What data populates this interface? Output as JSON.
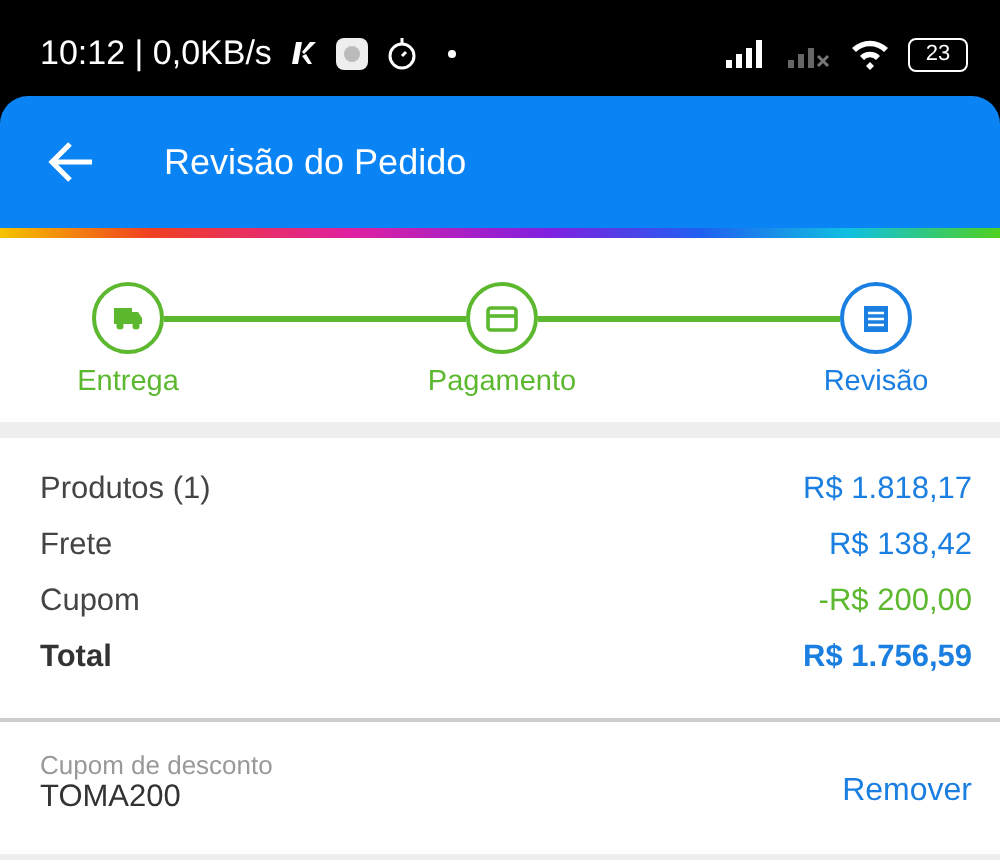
{
  "status_bar": {
    "time_speed": "10:12 | 0,0KB/s",
    "battery": "23"
  },
  "header": {
    "title": "Revisão do Pedido"
  },
  "steps": [
    {
      "label": "Entrega",
      "selected": false
    },
    {
      "label": "Pagamento",
      "selected": false
    },
    {
      "label": "Revisão",
      "selected": true
    }
  ],
  "summary": [
    {
      "label": "Produtos (1)",
      "value": "R$ 1.818,17",
      "kind": "normal"
    },
    {
      "label": "Frete",
      "value": "R$ 138,42",
      "kind": "normal"
    },
    {
      "label": "Cupom",
      "value": "-R$ 200,00",
      "kind": "discount"
    },
    {
      "label": "Total",
      "value": "R$ 1.756,59",
      "kind": "total"
    }
  ],
  "coupon": {
    "label": "Cupom de desconto",
    "code": "TOMA200",
    "action": "Remover"
  }
}
